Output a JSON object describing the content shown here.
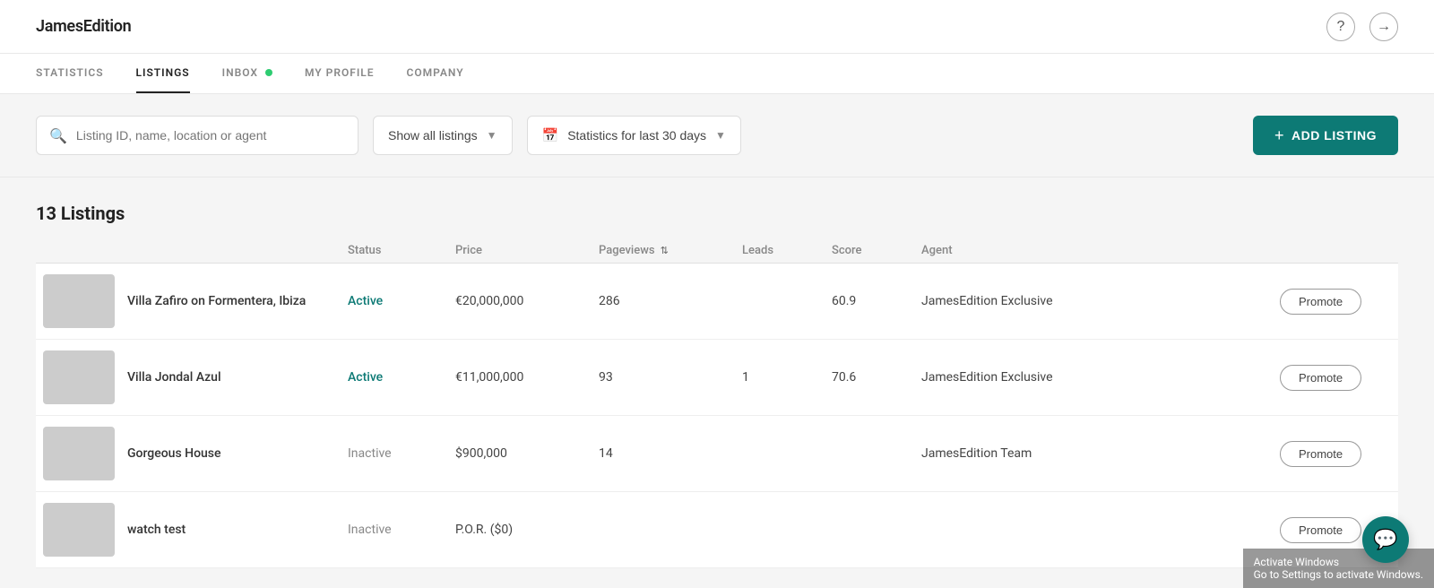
{
  "app": {
    "logo": "JamesEdition"
  },
  "nav": {
    "items": [
      {
        "id": "statistics",
        "label": "STATISTICS",
        "active": false,
        "badge": false
      },
      {
        "id": "listings",
        "label": "LISTINGS",
        "active": true,
        "badge": false
      },
      {
        "id": "inbox",
        "label": "INBOX",
        "active": false,
        "badge": true
      },
      {
        "id": "my-profile",
        "label": "MY PROFILE",
        "active": false,
        "badge": false
      },
      {
        "id": "company",
        "label": "COMPANY",
        "active": false,
        "badge": false
      }
    ]
  },
  "toolbar": {
    "search_placeholder": "Listing ID, name, location or agent",
    "show_listings_label": "Show all listings",
    "statistics_label": "Statistics for last 30 days",
    "add_listing_label": "ADD LISTING"
  },
  "listings_section": {
    "count_label": "13 Listings",
    "columns": {
      "status": "Status",
      "price": "Price",
      "pageviews": "Pageviews",
      "leads": "Leads",
      "score": "Score",
      "agent": "Agent"
    }
  },
  "listings": [
    {
      "id": "1",
      "name": "Villa Zafiro on Formentera, Ibiza",
      "status": "Active",
      "status_type": "active",
      "price": "€20,000,000",
      "pageviews": "286",
      "leads": "",
      "score": "60.9",
      "agent": "JamesEdition Exclusive",
      "thumb_class": "thumb-blue"
    },
    {
      "id": "2",
      "name": "Villa Jondal Azul",
      "status": "Active",
      "status_type": "active",
      "price": "€11,000,000",
      "pageviews": "93",
      "leads": "1",
      "score": "70.6",
      "agent": "JamesEdition Exclusive",
      "thumb_class": "thumb-green"
    },
    {
      "id": "3",
      "name": "Gorgeous House",
      "status": "Inactive",
      "status_type": "inactive",
      "price": "$900,000",
      "pageviews": "14",
      "leads": "",
      "score": "",
      "agent": "JamesEdition Team",
      "thumb_class": "thumb-house"
    },
    {
      "id": "4",
      "name": "watch test",
      "status": "Inactive",
      "status_type": "inactive",
      "price": "P.O.R. ($0)",
      "pageviews": "",
      "leads": "",
      "score": "",
      "agent": "",
      "thumb_class": "thumb-grey"
    }
  ],
  "promote_btn_label": "Promote",
  "chat_icon": "💬",
  "activation_line1": "Activate Windows",
  "activation_line2": "Go to Settings to activate Windows."
}
